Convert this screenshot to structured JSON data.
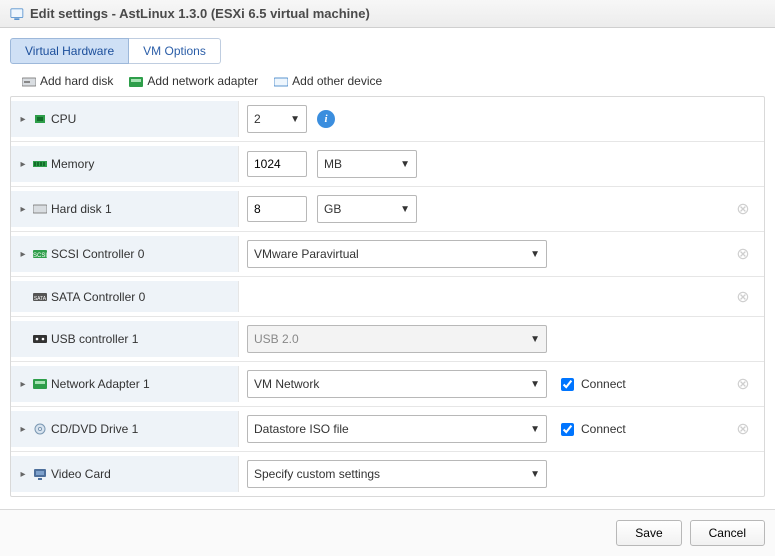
{
  "window": {
    "title": "Edit settings - AstLinux 1.3.0 (ESXi 6.5 virtual machine)"
  },
  "tabs": {
    "virtual_hardware": "Virtual Hardware",
    "vm_options": "VM Options"
  },
  "toolbar": {
    "add_hard_disk": "Add hard disk",
    "add_network_adapter": "Add network adapter",
    "add_other_device": "Add other device"
  },
  "rows": {
    "cpu": {
      "label": "CPU",
      "value": "2"
    },
    "memory": {
      "label": "Memory",
      "value": "1024",
      "unit": "MB"
    },
    "hd1": {
      "label": "Hard disk 1",
      "value": "8",
      "unit": "GB"
    },
    "scsi0": {
      "label": "SCSI Controller 0",
      "value": "VMware Paravirtual"
    },
    "sata0": {
      "label": "SATA Controller 0"
    },
    "usb1": {
      "label": "USB controller 1",
      "value": "USB 2.0"
    },
    "net1": {
      "label": "Network Adapter 1",
      "value": "VM Network",
      "connect": "Connect"
    },
    "cd1": {
      "label": "CD/DVD Drive 1",
      "value": "Datastore ISO file",
      "connect": "Connect"
    },
    "video": {
      "label": "Video Card",
      "value": "Specify custom settings"
    }
  },
  "footer": {
    "save": "Save",
    "cancel": "Cancel"
  }
}
